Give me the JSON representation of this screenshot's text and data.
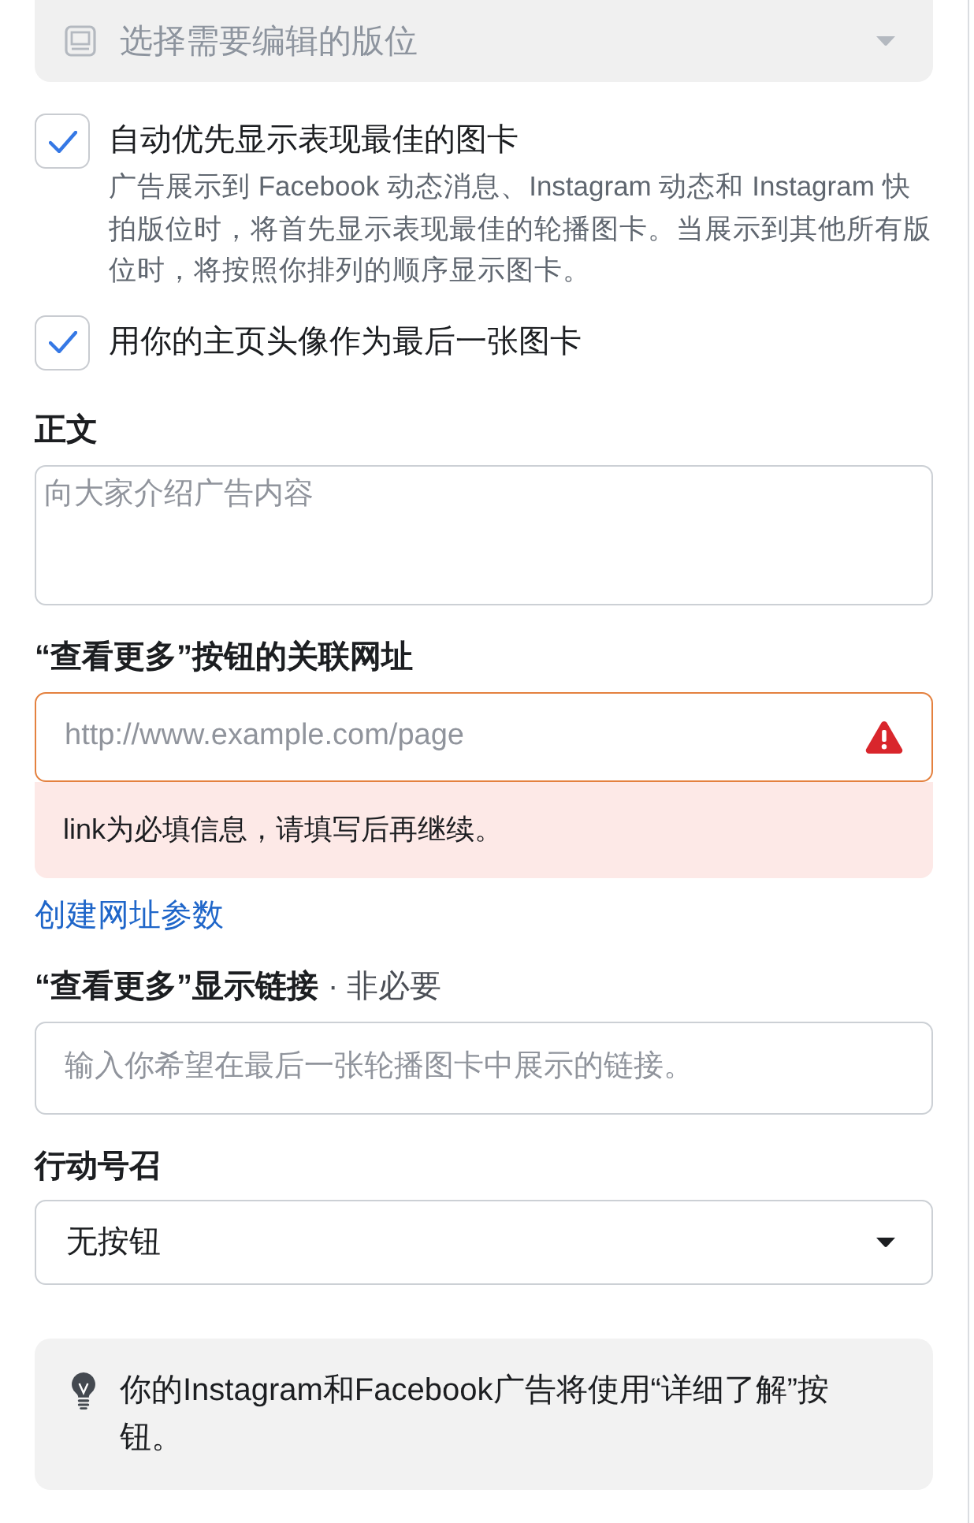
{
  "placement_select": {
    "placeholder": "选择需要编辑的版位",
    "disabled": true
  },
  "options": [
    {
      "label": "自动优先显示表现最佳的图卡",
      "checked": true,
      "description": "广告展示到 Facebook 动态消息、Instagram 动态和 Instagram 快拍版位时，将首先显示表现最佳的轮播图卡。当展示到其他所有版位时，将按照你排列的顺序显示图卡。"
    },
    {
      "label": "用你的主页头像作为最后一张图卡",
      "checked": true
    }
  ],
  "fields": [
    {
      "kind": "textarea",
      "label": "正文",
      "placeholder": "向大家介绍广告内容"
    },
    {
      "kind": "input",
      "label": "“查看更多”按钮的关联网址",
      "placeholder": "http://www.example.com/page",
      "error": "link为必填信息，请填写后再继续。",
      "link": "创建网址参数"
    },
    {
      "kind": "input",
      "label": "“查看更多”显示链接",
      "optional": "· 非必要",
      "placeholder": "输入你希望在最后一张轮播图卡中展示的链接。"
    },
    {
      "kind": "select",
      "label": "行动号召",
      "value": "无按钮"
    }
  ],
  "notice": {
    "text": "你的Instagram和Facebook广告将使用“详细了解”按钮。"
  }
}
